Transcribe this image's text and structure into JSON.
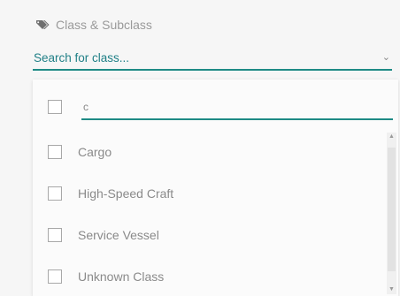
{
  "filter": {
    "label": "Class & Subclass",
    "label_icon": "tag-icon",
    "placeholder": "Search for class...",
    "caret_icon": "chevron-down-icon",
    "accent_color": "#1e8a85"
  },
  "dropdown": {
    "search_value": "c",
    "options": [
      {
        "label": "Cargo",
        "checked": false
      },
      {
        "label": "High-Speed Craft",
        "checked": false
      },
      {
        "label": "Service Vessel",
        "checked": false
      },
      {
        "label": "Unknown Class",
        "checked": false
      }
    ]
  }
}
